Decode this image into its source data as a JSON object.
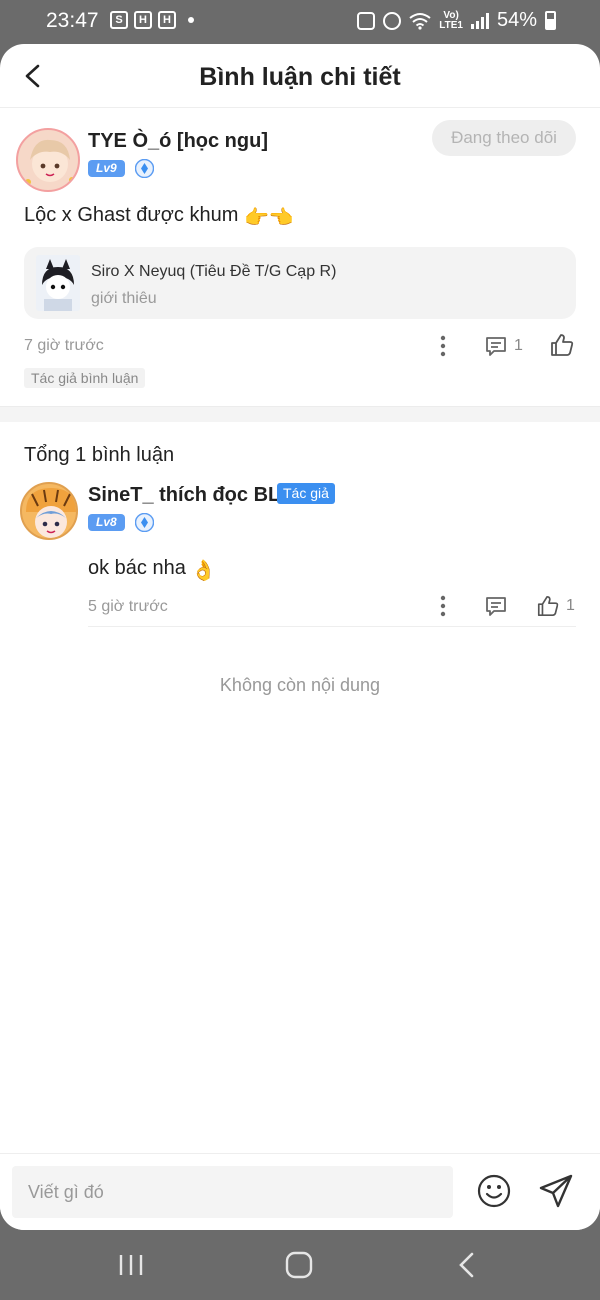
{
  "status_bar": {
    "time": "23:47",
    "battery": "54%",
    "network": "LTE1"
  },
  "header": {
    "title": "Bình luận chi tiết",
    "back_icon": "chevron-left-icon"
  },
  "main_comment": {
    "author": "TYE Ò_ó [học ngu]",
    "level": "Lv9",
    "follow_label": "Đang theo dõi",
    "text": "Lộc x Ghast được khum",
    "emoji": "👉👈",
    "book": {
      "title": "Siro X Neyuq (Tiêu Đề T/G Cạp R)",
      "subtitle": "giới thiêu"
    },
    "time": "7 giờ trước",
    "reply_count": "1",
    "tag": "Tác giả bình luận"
  },
  "replies": {
    "count_label": "Tổng 1 bình luận",
    "items": [
      {
        "author": "SineT_ thích đọc BL",
        "badge": "Tác giả",
        "level": "Lv8",
        "text": "ok bác nha",
        "emoji": "👌",
        "time": "5 giờ trước",
        "like_count": "1"
      }
    ],
    "end_text": "Không còn nội dung"
  },
  "input": {
    "placeholder": "Viết gì đó"
  },
  "colors": {
    "accent": "#3b8ff0",
    "level_badge": "#5b9cf2",
    "muted": "#999999"
  }
}
